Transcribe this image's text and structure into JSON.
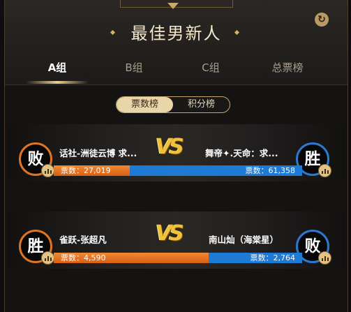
{
  "title": "最佳男新人",
  "tabs": [
    {
      "label": "A组",
      "active": true
    },
    {
      "label": "B组",
      "active": false
    },
    {
      "label": "C组",
      "active": false
    },
    {
      "label": "总票榜",
      "active": false
    }
  ],
  "toggle": {
    "selected": "票数榜",
    "other": "积分榜"
  },
  "vs_text": "VS",
  "matches": [
    {
      "left": {
        "name": "话社-洲徒云博 求...",
        "result": "败",
        "votes_text": "票数：27,019",
        "votes": 27019
      },
      "right": {
        "name": "舞帝✦.天命：求...",
        "result": "胜",
        "votes_text": "票数：61,358",
        "votes": 61358
      }
    },
    {
      "left": {
        "name": "雀跃-张超凡",
        "result": "胜",
        "votes_text": "票数：4,590",
        "votes": 4590
      },
      "right": {
        "name": "南山灿（海棠星）",
        "result": "败",
        "votes_text": "票数：2,764",
        "votes": 2764
      }
    }
  ],
  "colors": {
    "left_bar": "#e06a1c",
    "right_bar": "#1f7ad3",
    "gold": "#e9d6a8"
  },
  "icons": {
    "refresh": "refresh-icon",
    "stats": "bar-chart-icon"
  }
}
